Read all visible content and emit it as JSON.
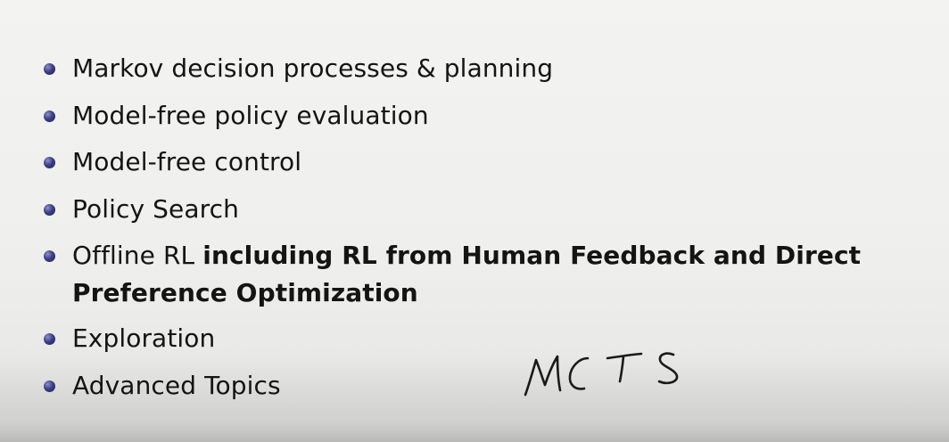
{
  "slide": {
    "bullets": [
      {
        "text": "Markov decision processes & planning"
      },
      {
        "text": "Model-free policy evaluation"
      },
      {
        "text": "Model-free control"
      },
      {
        "text": "Policy Search"
      },
      {
        "text": "Offline RL ",
        "bold": "including RL from Human Feedback and Direct Preference Optimization"
      },
      {
        "text": "Exploration"
      },
      {
        "text": "Advanced Topics"
      }
    ],
    "annotation": "MCTS"
  },
  "colors": {
    "bullet": "#3c3f86",
    "text": "#141414",
    "ink": "#1a1a1a"
  }
}
